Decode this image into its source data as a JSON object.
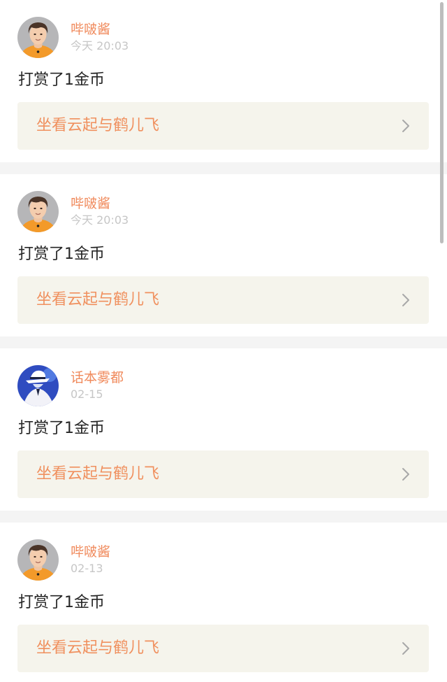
{
  "feed": {
    "items": [
      {
        "username": "哔啵酱",
        "time": "今天 20:03",
        "message": "打赏了1金币",
        "ref_title": "坐看云起与鹤儿飞",
        "avatar": "portrait-young-man-orange-shirt-avatar"
      },
      {
        "username": "哔啵酱",
        "time": "今天 20:03",
        "message": "打赏了1金币",
        "ref_title": "坐看云起与鹤儿飞",
        "avatar": "portrait-young-man-orange-shirt-avatar"
      },
      {
        "username": "话本雾都",
        "time": "02-15",
        "message": "打赏了1金币",
        "ref_title": "坐看云起与鹤儿飞",
        "avatar": "anime-white-hat-character-avatar"
      },
      {
        "username": "哔啵酱",
        "time": "02-13",
        "message": "打赏了1金币",
        "ref_title": "坐看云起与鹤儿飞",
        "avatar": "portrait-young-man-orange-shirt-avatar"
      }
    ]
  },
  "colors": {
    "username": "#f08a5c",
    "reference_text": "#f0905e",
    "reference_bg": "#f5f4ec",
    "timestamp": "#c6c6c6",
    "message": "#262626",
    "separator": "#f4f4f4"
  },
  "icons": {
    "chevron": "chevron-right-icon"
  }
}
